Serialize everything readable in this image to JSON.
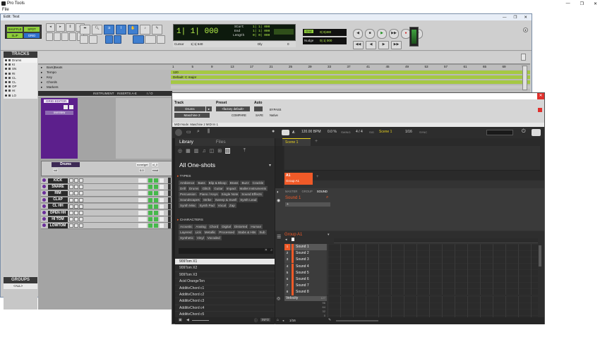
{
  "app": {
    "title": "Pro Tools",
    "menu_file": "File",
    "window_controls": [
      "—",
      "❐",
      "✕"
    ]
  },
  "edit_window": {
    "title": "Edit: Test",
    "window_controls": [
      "—",
      "❐",
      "✕"
    ],
    "modes": {
      "shuffle": "SHUFFLE",
      "spot": "SPOT",
      "slip": "SLIP",
      "grid": "GRID"
    },
    "counter_main": "1| 1| 000",
    "counter_labels": {
      "start": "Start",
      "end": "End",
      "length": "Length"
    },
    "counter_values": {
      "start": "1| 1| 000",
      "end": "1| 1| 000",
      "length": "0| 0| 000"
    },
    "cursor_label": "Cursor",
    "cursor_value": "1| 1| 640",
    "dly_label": "Dly",
    "pre_value": "0",
    "grid_label": "Grid",
    "grid_value": "0| 0|480",
    "nudge_label": "Nudge",
    "nudge_value": "0| 1| 000",
    "tracks_panel": {
      "header": "TRACKS",
      "items": [
        "Drums",
        "KI",
        "SN",
        "RI",
        "CL",
        "CL",
        "OP",
        "HI",
        "LO"
      ]
    },
    "groups_panel": {
      "header": "GROUPS",
      "items": [
        "<ALL>"
      ]
    },
    "rulers": [
      {
        "label": "Bars|Beats"
      },
      {
        "label": "Tempo",
        "value": "120"
      },
      {
        "label": "Key",
        "value": "Default: C major"
      },
      {
        "label": "Chords"
      },
      {
        "label": "Markers"
      }
    ],
    "bar_numbers": [
      "1",
      "5",
      "9",
      "13",
      "17",
      "21",
      "25",
      "29",
      "33",
      "37",
      "41",
      "45",
      "49",
      "53",
      "57",
      "61",
      "65",
      "69",
      "73"
    ],
    "columns": {
      "instrument": "INSTRUMENT",
      "inserts": "INSERTS A-E",
      "io": "I / O"
    },
    "grid_editor_label": "GRID EDITOR",
    "overview_label": "overview",
    "drums_track": {
      "name": "Drums",
      "vol": "vol",
      "vol_value": "0.0",
      "mode": "none/get",
      "pan": "cl_0",
      "read": "read"
    },
    "tracks": [
      "KICK",
      "SNARE",
      "RIM",
      "CLAP",
      "CL HH",
      "OPEN HH",
      "HI TOM",
      "LOWTOM"
    ]
  },
  "maschine": {
    "plugin": {
      "track_label": "Track",
      "preset_label": "Preset",
      "auto_label": "Auto",
      "track_value": "Drums",
      "insert_value": "Maschine 2",
      "preset_value": "<factory default>",
      "compare": "COMPARE",
      "safe": "SAFE",
      "native": "Native",
      "bypass": "BYPASS",
      "midi_node": "MIDI Node: Maschine 2 MIDI In 1"
    },
    "toolbar": {
      "tempo": "120.00 BPM",
      "swing": "0.0 %",
      "swing_label": "SWING",
      "sig": "4 / 4",
      "sig_label": "SIG",
      "scene": "Scene 1",
      "position": "1/16",
      "sync": "SYNC"
    },
    "library": {
      "tabs": [
        "Library",
        "Files"
      ],
      "selector": "All One-shots",
      "types_header": "TYPES",
      "types": [
        "Ambience",
        "Bass",
        "Blip & Bloop",
        "Brass",
        "Buzz",
        "Crackle",
        "Drill",
        "Drums",
        "Glitch",
        "Guitar",
        "Impact",
        "Mallet Instruments",
        "Percussion",
        "Piano / Keys",
        "Single Note",
        "Sound Effects",
        "Soundscapes",
        "Strike",
        "Sweep & Swell",
        "Synth Lead",
        "Synth Misc",
        "Synth Pad",
        "Vocal",
        "Zap"
      ],
      "characters_header": "CHARACTERS",
      "characters": [
        "Acoustic",
        "Analog",
        "Chord",
        "Digital",
        "Distorted",
        "Human",
        "Layered",
        "Lick",
        "Metallic",
        "Processed",
        "Stabs & Hits",
        "Sub",
        "Synthetic",
        "Vinyl",
        "Vocoded"
      ],
      "items": [
        "909Tom X1",
        "909Tom X2",
        "909Tom X3",
        "Acid OrangeTen",
        "AdditivChord c1",
        "AdditivChord c2",
        "AdditivChord c3",
        "AdditivChord c4",
        "AdditivChord c5",
        "AdditivChord c6"
      ],
      "selected_index": 0,
      "footer_info": "INFO"
    },
    "arranger": {
      "scene": "Scene 1",
      "pattern_slot": "A1",
      "pattern_group": "Group A1",
      "tabs": [
        "MASTER",
        "GROUP",
        "SOUND"
      ],
      "sound_name": "Sound 1"
    },
    "pattern_editor": {
      "group": "Group A1",
      "sounds": [
        "Sound 1",
        "Sound 2",
        "Sound 3",
        "Sound 4",
        "Sound 5",
        "Sound 6",
        "Sound 7",
        "Sound 8"
      ],
      "numbers": [
        "1",
        "2",
        "3",
        "4",
        "5",
        "6",
        "7",
        "8"
      ],
      "velocity_label": "Velocity",
      "velocity_ticks": [
        "127",
        "96",
        "64",
        "32",
        "0"
      ],
      "position": "1/16"
    },
    "colors": {
      "accent": "#f05a28",
      "yellow": "#e9d21f"
    }
  }
}
